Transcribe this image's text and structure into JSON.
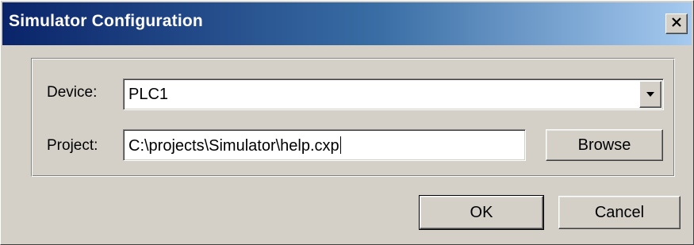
{
  "window": {
    "title": "Simulator Configuration"
  },
  "form": {
    "device_label": "Device:",
    "device_value": "PLC1",
    "project_label": "Project:",
    "project_value": "C:\\projects\\Simulator\\help.cxp",
    "browse_label": "Browse"
  },
  "footer": {
    "ok_label": "OK",
    "cancel_label": "Cancel"
  },
  "icons": {
    "close": "close-icon",
    "dropdown": "chevron-down-icon"
  },
  "colors": {
    "title_start": "#0a246a",
    "title_end": "#a6caf0",
    "face": "#d4d0c8"
  }
}
